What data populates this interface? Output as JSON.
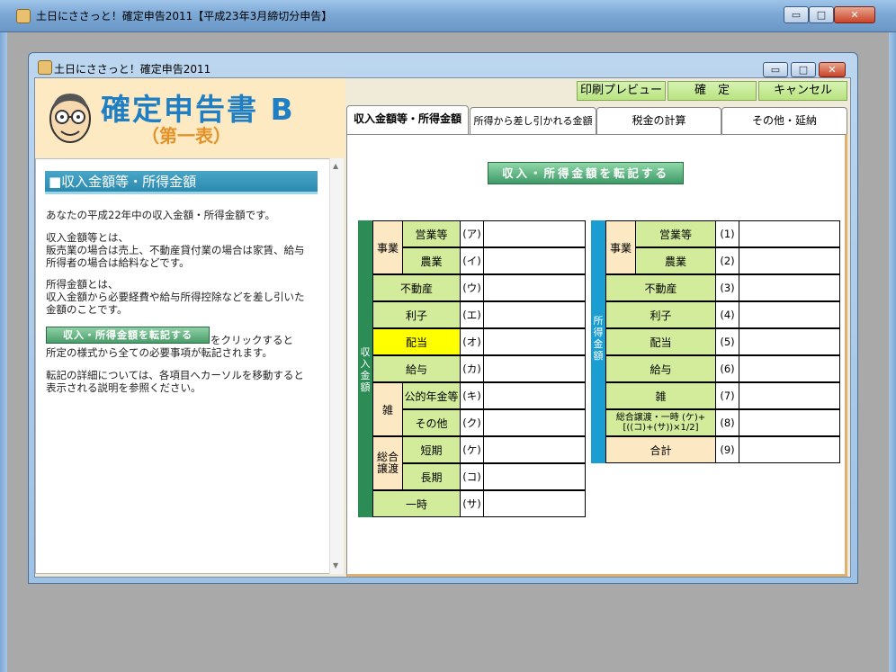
{
  "outer_window": {
    "title": "土日にささっと！確定申告2011【平成23年3月締切分申告】",
    "min": "▭",
    "max": "□",
    "close": "✕"
  },
  "inner_window": {
    "title": "土日にささっと！確定申告2011",
    "min": "▭",
    "max": "□",
    "close": "✕"
  },
  "header": {
    "title": "確定申告書 B",
    "subtitle": "（第一表）"
  },
  "toolbar": {
    "print_preview": "印刷プレビュー",
    "confirm": "確　定",
    "cancel": "キャンセル"
  },
  "tabs": [
    {
      "label": "収入金額等・所得金額",
      "active": true
    },
    {
      "label": "所得から差し引かれる金額",
      "active": false
    },
    {
      "label": "税金の計算",
      "active": false
    },
    {
      "label": "その他・延納",
      "active": false
    }
  ],
  "left_panel": {
    "heading": "■収入金額等・所得金額",
    "lines": [
      "あなたの平成22年中の収入金額・所得金額です。",
      "収入金額等とは、",
      "販売業の場合は売上、不動産貸付業の場合は家賃、給与",
      "所得者の場合は給料などです。",
      "所得金額とは、",
      "収入金額から必要経費や給与所得控除などを差し引いた",
      "金額のことです。",
      "をクリックすると",
      "所定の様式から全ての必要事項が転記されます。",
      "転記の詳細については、各項目へカーソルを移動すると",
      "表示される説明を参照ください。"
    ],
    "inline_button": "収入・所得金額を転記する"
  },
  "transfer_button": "収入・所得金額を転記する",
  "income_table": {
    "side_label": "収入金額",
    "groups": {
      "business": "事業",
      "misc": "雑",
      "general_transfer": "総合譲渡"
    },
    "rows": [
      {
        "label": "営業等",
        "code": "(ア)",
        "value": ""
      },
      {
        "label": "農業",
        "code": "(イ)",
        "value": ""
      },
      {
        "label": "不動産",
        "code": "(ウ)",
        "value": ""
      },
      {
        "label": "利子",
        "code": "(エ)",
        "value": ""
      },
      {
        "label": "配当",
        "code": "(オ)",
        "value": ""
      },
      {
        "label": "給与",
        "code": "(カ)",
        "value": ""
      },
      {
        "label": "公的年金等",
        "code": "(キ)",
        "value": ""
      },
      {
        "label": "その他",
        "code": "(ク)",
        "value": ""
      },
      {
        "label": "短期",
        "code": "(ケ)",
        "value": ""
      },
      {
        "label": "長期",
        "code": "(コ)",
        "value": ""
      },
      {
        "label": "一時",
        "code": "(サ)",
        "value": ""
      }
    ]
  },
  "income_amount_table": {
    "side_label": "所得金額",
    "groups": {
      "business": "事業"
    },
    "rows": [
      {
        "label": "営業等",
        "code": "(1)",
        "value": ""
      },
      {
        "label": "農業",
        "code": "(2)",
        "value": ""
      },
      {
        "label": "不動産",
        "code": "(3)",
        "value": ""
      },
      {
        "label": "利子",
        "code": "(4)",
        "value": ""
      },
      {
        "label": "配当",
        "code": "(5)",
        "value": ""
      },
      {
        "label": "給与",
        "code": "(6)",
        "value": ""
      },
      {
        "label": "雑",
        "code": "(7)",
        "value": ""
      },
      {
        "label": "総合譲渡・一時 (ケ)+[((コ)+(サ))×1/2]",
        "code": "(8)",
        "value": ""
      },
      {
        "label": "合計",
        "code": "(9)",
        "value": ""
      }
    ]
  },
  "colors": {
    "label_green": "#d2ec9c",
    "highlight_yellow": "#ffff00",
    "side_green": "#2c8c56",
    "side_blue": "#1a9dd0",
    "title_blue": "#1f7fc4"
  }
}
